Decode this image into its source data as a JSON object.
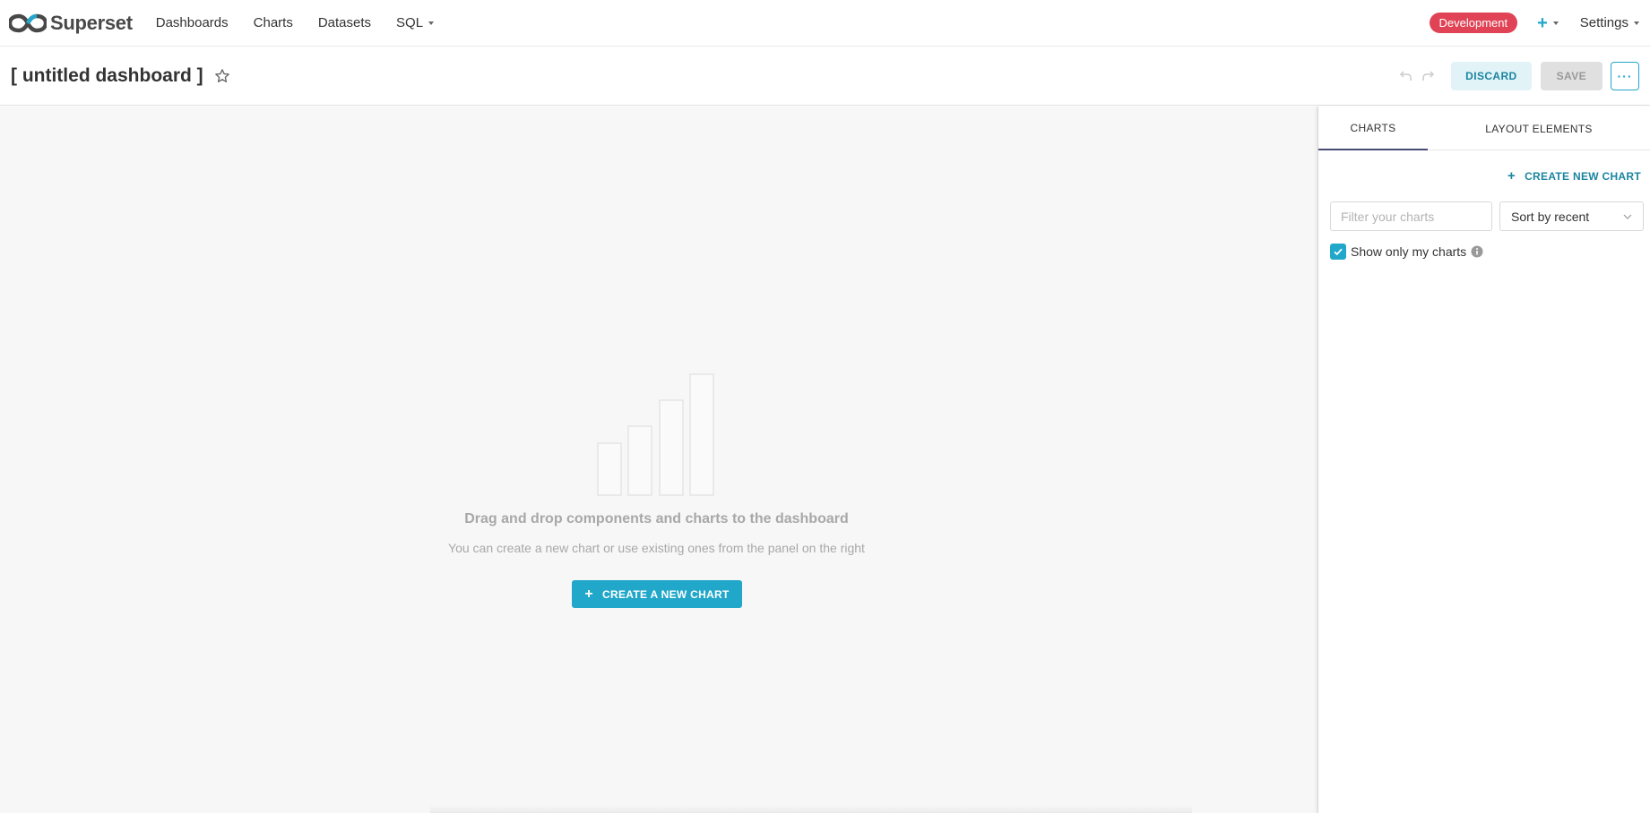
{
  "brand": {
    "name": "Superset"
  },
  "nav": {
    "dashboards": "Dashboards",
    "charts": "Charts",
    "datasets": "Datasets",
    "sql": "SQL",
    "environment_badge": "Development",
    "settings": "Settings"
  },
  "header": {
    "title": "[ untitled dashboard ]",
    "discard": "DISCARD",
    "save": "SAVE",
    "more": "···"
  },
  "empty_state": {
    "title": "Drag and drop components and charts to the dashboard",
    "subtitle": "You can create a new chart or use existing ones from the panel on the right",
    "create_button": "CREATE A NEW CHART"
  },
  "panel": {
    "tabs": [
      "CHARTS",
      "LAYOUT ELEMENTS"
    ],
    "active_tab": "CHARTS",
    "create_link": "CREATE NEW CHART",
    "filter_placeholder": "Filter your charts",
    "filter_value": "",
    "sort_selected": "Sort by recent",
    "show_only_mine_label": "Show only my charts",
    "show_only_mine_checked": true
  },
  "colors": {
    "accent": "#20a7c9",
    "badge": "#e04355",
    "tab_underline": "#484b74"
  },
  "icons": {
    "logo": "superset-logo-icon",
    "star": "star-icon",
    "undo": "undo-icon",
    "redo": "redo-icon",
    "info": "info-icon",
    "check": "check-icon",
    "chevron": "chevron-down-icon"
  }
}
